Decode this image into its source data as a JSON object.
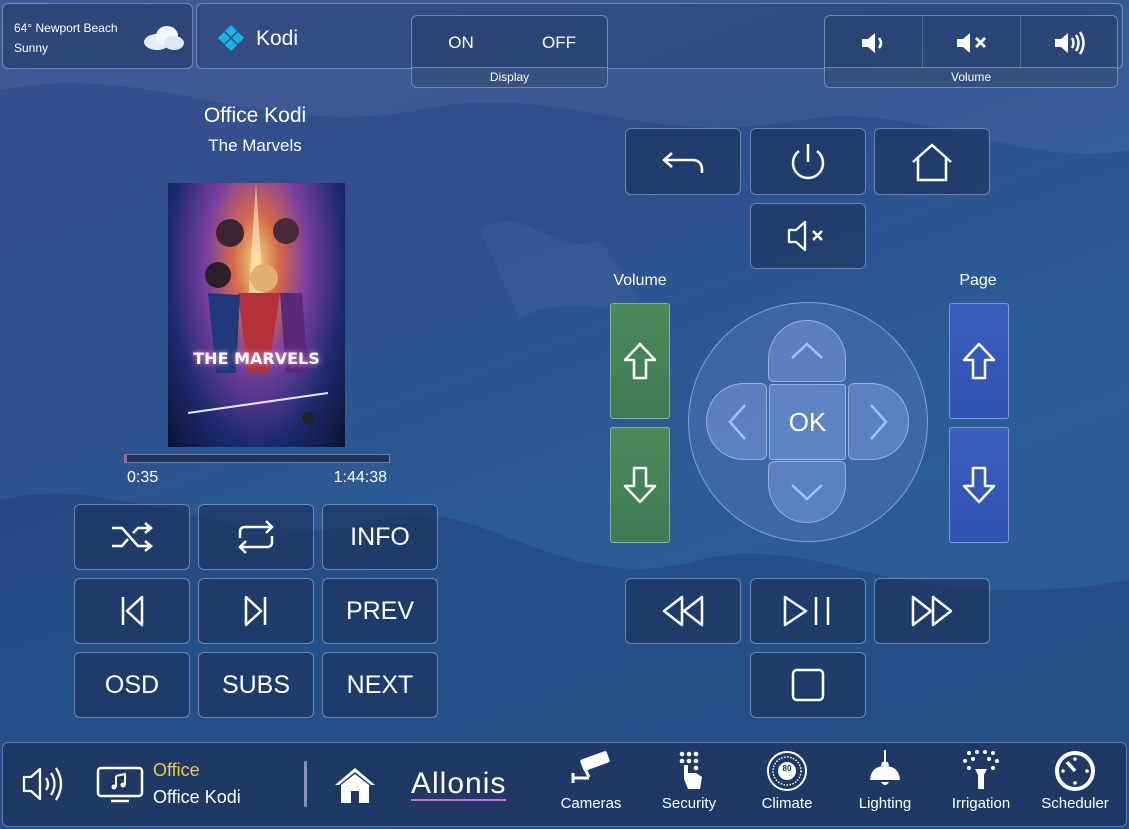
{
  "weather": {
    "line1": "64° Newport Beach",
    "line2": "Sunny",
    "icon": "cloud-icon"
  },
  "app": {
    "name": "Kodi",
    "icon": "kodi-logo-icon"
  },
  "display": {
    "on_label": "ON",
    "off_label": "OFF",
    "caption": "Display"
  },
  "volume_top": {
    "caption": "Volume",
    "icons": [
      "volume-down-icon",
      "mute-icon",
      "volume-up-icon"
    ]
  },
  "now_playing": {
    "room": "Office Kodi",
    "title": "The Marvels",
    "poster_text": "THE MARVELS",
    "elapsed": "0:35",
    "duration": "1:44:38",
    "progress_fraction": 0.006
  },
  "transport_left": {
    "info_label": "INFO",
    "prev_label": "PREV",
    "osd_label": "OSD",
    "subs_label": "SUBS",
    "next_label": "NEXT"
  },
  "remote": {
    "ok_label": "OK",
    "volume_label": "Volume",
    "page_label": "Page"
  },
  "footer": {
    "room": "Office",
    "source": "Office Kodi",
    "brand": "Allonis",
    "nav": [
      "Cameras",
      "Security",
      "Climate",
      "Lighting",
      "Irrigation",
      "Scheduler"
    ],
    "climate_value": "80"
  },
  "colors": {
    "accent": "#f0c94a",
    "green": "#437f56",
    "blue": "#3457b8",
    "brand": "#c96bd8"
  }
}
